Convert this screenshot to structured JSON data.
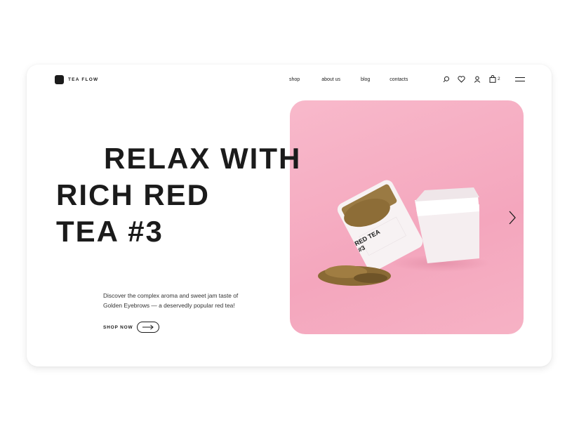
{
  "brand": {
    "name": "TEA FLOW"
  },
  "nav": [
    {
      "label": "shop"
    },
    {
      "label": "about us"
    },
    {
      "label": "blog"
    },
    {
      "label": "contacts"
    }
  ],
  "header_icons": [
    "search-icon",
    "heart-icon",
    "user-icon",
    "cart-icon",
    "menu-icon"
  ],
  "cart": {
    "count": "2"
  },
  "hero": {
    "title_lines": [
      "RELAX WITH",
      "RICH RED",
      "TEA #3"
    ],
    "description_lines": [
      "Discover the complex aroma and sweet jam taste of",
      "Golden Eyebrows — a deservedly popular red tea!"
    ],
    "cta_label": "SHOP NOW",
    "tin_label_lines": [
      "RED TEA",
      "#3"
    ]
  },
  "colors": {
    "text": "#1b1b1b",
    "hero_bg": "#f4a6bd",
    "tin": "#f7f2f3",
    "tea": "#8a6a35"
  }
}
